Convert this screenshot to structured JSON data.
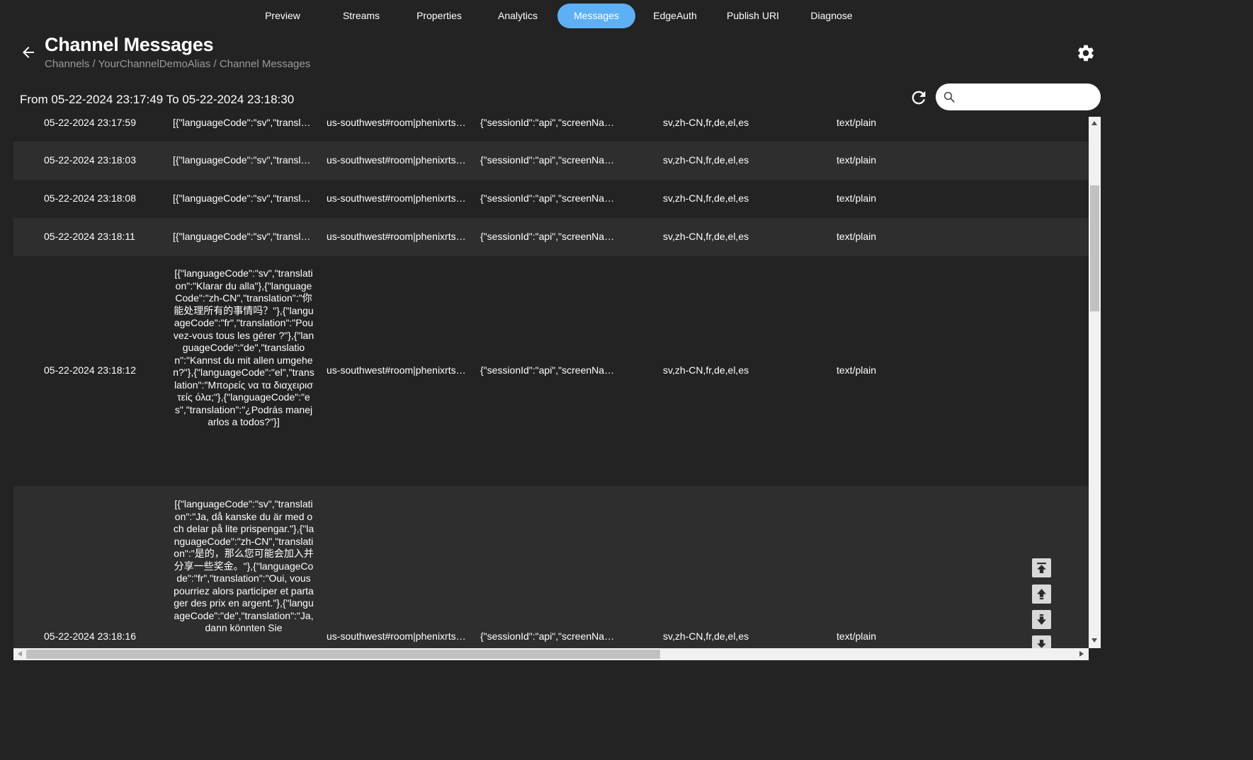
{
  "tabs": [
    {
      "label": "Preview"
    },
    {
      "label": "Streams"
    },
    {
      "label": "Properties"
    },
    {
      "label": "Analytics"
    },
    {
      "label": "Messages",
      "active": true
    },
    {
      "label": "EdgeAuth"
    },
    {
      "label": "Publish URI"
    },
    {
      "label": "Diagnose"
    }
  ],
  "header": {
    "title": "Channel Messages",
    "breadcrumb": "Channels / YourChannelDemoAlias / Channel Messages"
  },
  "range": {
    "text": "From 05-22-2024 23:17:49 To 05-22-2024 23:18:30"
  },
  "search": {
    "value": "",
    "placeholder": ""
  },
  "colors": {
    "accent": "#5eb0f5",
    "background": "#232323",
    "row_alt": "#2e2e2e"
  },
  "icons": {
    "back": "arrow-left-icon",
    "settings": "gear-icon",
    "refresh": "refresh-icon",
    "search": "search-icon",
    "first": "scroll-to-top-icon",
    "prev": "page-up-icon",
    "next": "page-down-icon",
    "last": "scroll-to-bottom-icon"
  },
  "messages": [
    {
      "timestamp": "05-22-2024 23:17:59",
      "body": "[{\"languageCode\":\"sv\",\"translat…",
      "channel": "us-southwest#room|phenixrts…",
      "from": "{\"sessionId\":\"api\",\"screenNam…",
      "tags": "sv,zh-CN,fr,de,el,es",
      "mime": "text/plain"
    },
    {
      "timestamp": "05-22-2024 23:18:03",
      "body": "[{\"languageCode\":\"sv\",\"translat…",
      "channel": "us-southwest#room|phenixrts…",
      "from": "{\"sessionId\":\"api\",\"screenNam…",
      "tags": "sv,zh-CN,fr,de,el,es",
      "mime": "text/plain"
    },
    {
      "timestamp": "05-22-2024 23:18:08",
      "body": "[{\"languageCode\":\"sv\",\"translat…",
      "channel": "us-southwest#room|phenixrts…",
      "from": "{\"sessionId\":\"api\",\"screenNam…",
      "tags": "sv,zh-CN,fr,de,el,es",
      "mime": "text/plain"
    },
    {
      "timestamp": "05-22-2024 23:18:11",
      "body": "[{\"languageCode\":\"sv\",\"translat…",
      "channel": "us-southwest#room|phenixrts…",
      "from": "{\"sessionId\":\"api\",\"screenNam…",
      "tags": "sv,zh-CN,fr,de,el,es",
      "mime": "text/plain"
    },
    {
      "timestamp": "05-22-2024 23:18:12",
      "body": "[{\"languageCode\":\"sv\",\"translation\":\"Klarar du alla\"},{\"languageCode\":\"zh-CN\",\"translation\":\"你能处理所有的事情吗？\"},{\"languageCode\":\"fr\",\"translation\":\"Pouvez-vous tous les gérer ?\"},{\"languageCode\":\"de\",\"translation\":\"Kannst du mit allen umgehen?\"},{\"languageCode\":\"el\",\"translation\":\"Μπορείς να τα διαχειριστείς όλα;\"},{\"languageCode\":\"es\",\"translation\":\"¿Podrás manejarlos a todos?\"}]",
      "channel": "us-southwest#room|phenixrts…",
      "from": "{\"sessionId\":\"api\",\"screenNam…",
      "tags": "sv,zh-CN,fr,de,el,es",
      "mime": "text/plain"
    },
    {
      "timestamp": "05-22-2024 23:18:16",
      "body": "[{\"languageCode\":\"sv\",\"translation\":\"Ja, då kanske du är med och delar på lite prispengar.\"},{\"languageCode\":\"zh-CN\",\"translation\":\"是的，那么您可能会加入并分享一些奖金。\"},{\"languageCode\":\"fr\",\"translation\":\"Oui, vous pourriez alors participer et partager des prix en argent.\"},{\"languageCode\":\"de\",\"translation\":\"Ja, dann könnten Sie",
      "channel": "us-southwest#room|phenixrts…",
      "from": "{\"sessionId\":\"api\",\"screenNam…",
      "tags": "sv,zh-CN,fr,de,el,es",
      "mime": "text/plain"
    }
  ]
}
